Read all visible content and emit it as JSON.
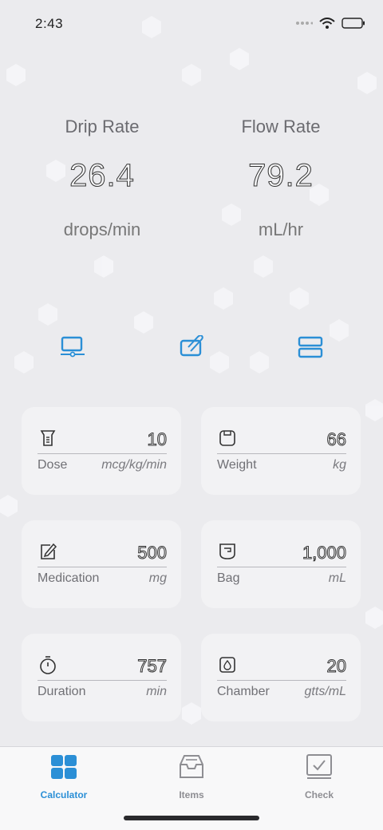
{
  "status": {
    "time": "2:43"
  },
  "results": {
    "drip": {
      "label": "Drip Rate",
      "value": "26.4",
      "unit": "drops/min"
    },
    "flow": {
      "label": "Flow Rate",
      "value": "79.2",
      "unit": "mL/hr"
    }
  },
  "modes": [
    "monitor-icon",
    "edit-attach-icon",
    "rows-icon"
  ],
  "fields": [
    {
      "name": "Dose",
      "value": "10",
      "unit": "mcg/kg/min",
      "icon": "dose-icon"
    },
    {
      "name": "Weight",
      "value": "66",
      "unit": "kg",
      "icon": "scale-icon"
    },
    {
      "name": "Medication",
      "value": "500",
      "unit": "mg",
      "icon": "pencil-icon"
    },
    {
      "name": "Bag",
      "value": "1,000",
      "unit": "mL",
      "icon": "bag-icon"
    },
    {
      "name": "Duration",
      "value": "757",
      "unit": "min",
      "icon": "stopwatch-icon"
    },
    {
      "name": "Chamber",
      "value": "20",
      "unit": "gtts/mL",
      "icon": "drop-chamber-icon"
    }
  ],
  "tabs": [
    {
      "label": "Calculator",
      "icon": "grid-icon",
      "active": true
    },
    {
      "label": "Items",
      "icon": "tray-icon",
      "active": false
    },
    {
      "label": "Check",
      "icon": "checkbox-icon",
      "active": false
    }
  ],
  "colors": {
    "accent": "#2b8fd6",
    "background": "#ebebee"
  }
}
